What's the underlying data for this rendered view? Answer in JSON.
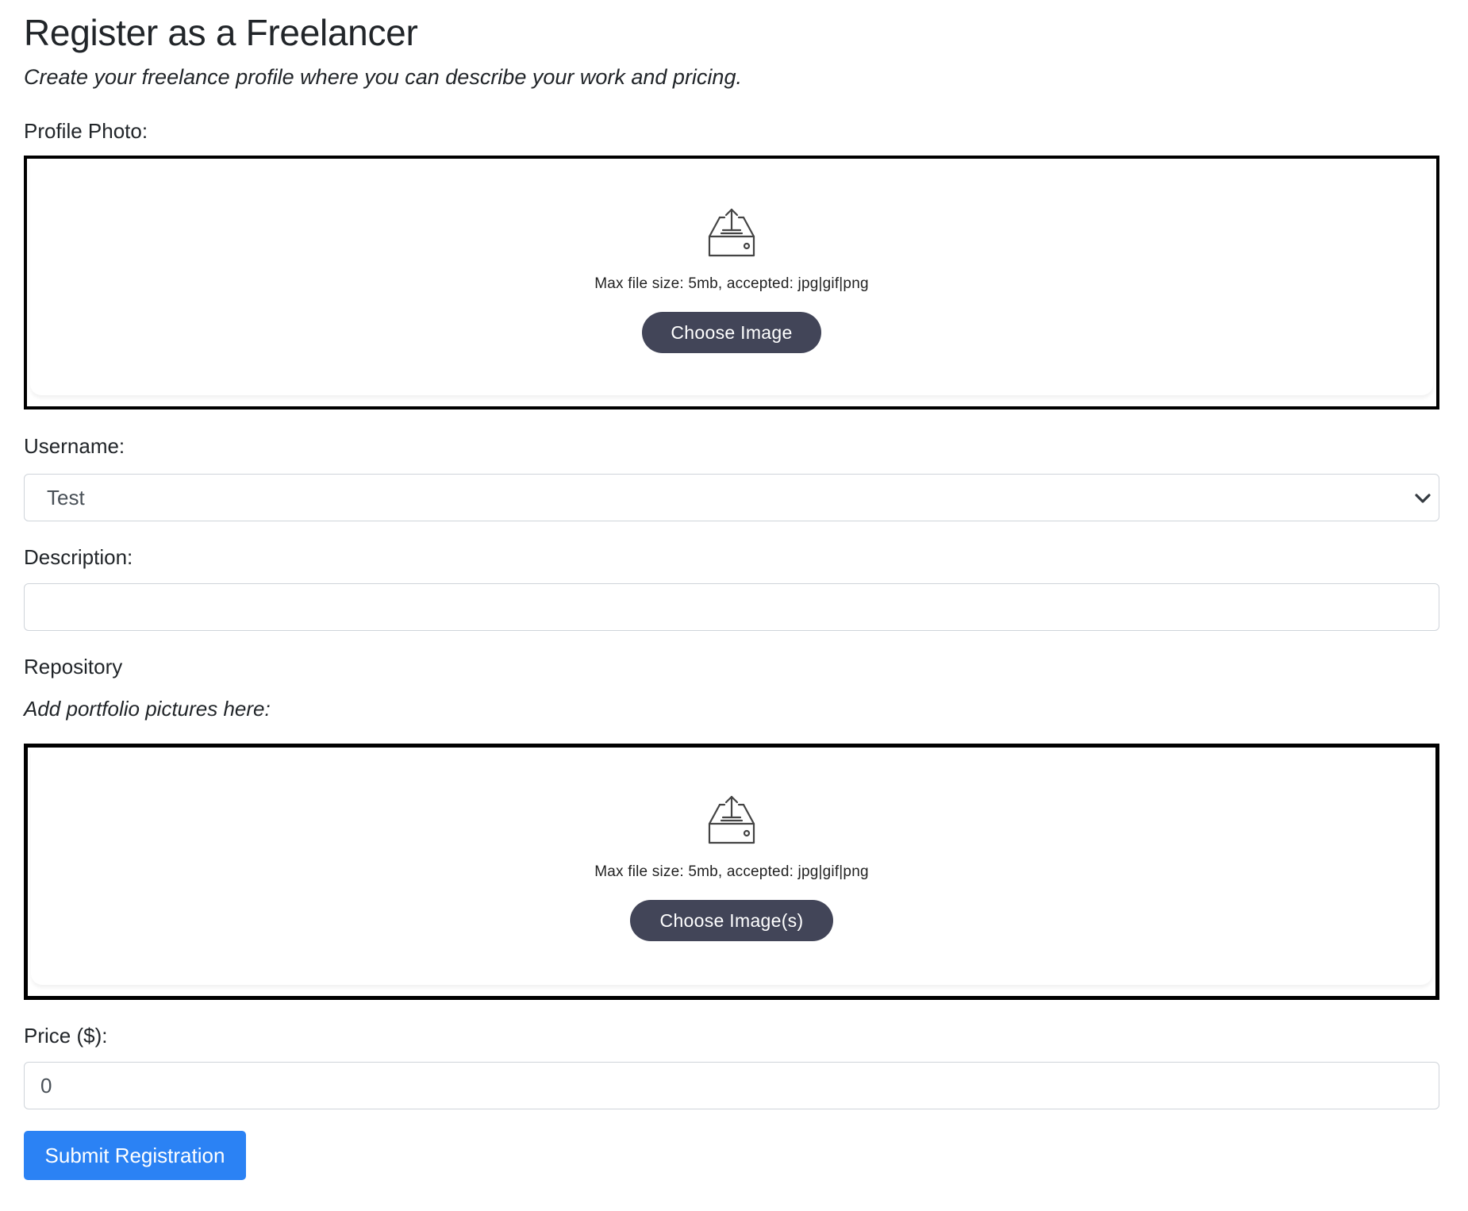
{
  "header": {
    "title": "Register as a Freelancer",
    "subtitle": "Create your freelance profile where you can describe your work and pricing."
  },
  "profile_photo": {
    "label": "Profile Photo:",
    "hint": "Max file size: 5mb, accepted: jpg|gif|png",
    "button_label": "Choose Image",
    "icon": "upload-tray-icon"
  },
  "username": {
    "label": "Username:",
    "selected": "Test",
    "icon": "chevron-down-icon"
  },
  "description": {
    "label": "Description:",
    "value": "",
    "placeholder": ""
  },
  "repository": {
    "label": "Repository",
    "sublabel": "Add portfolio pictures here:",
    "hint": "Max file size: 5mb, accepted: jpg|gif|png",
    "button_label": "Choose Image(s)",
    "icon": "upload-tray-icon"
  },
  "price": {
    "label": "Price ($):",
    "value": "0"
  },
  "submit": {
    "label": "Submit Registration"
  },
  "colors": {
    "accent": "#2b82f4",
    "choose_button": "#424558",
    "text": "#212529",
    "dropzone_border": "#000000"
  }
}
